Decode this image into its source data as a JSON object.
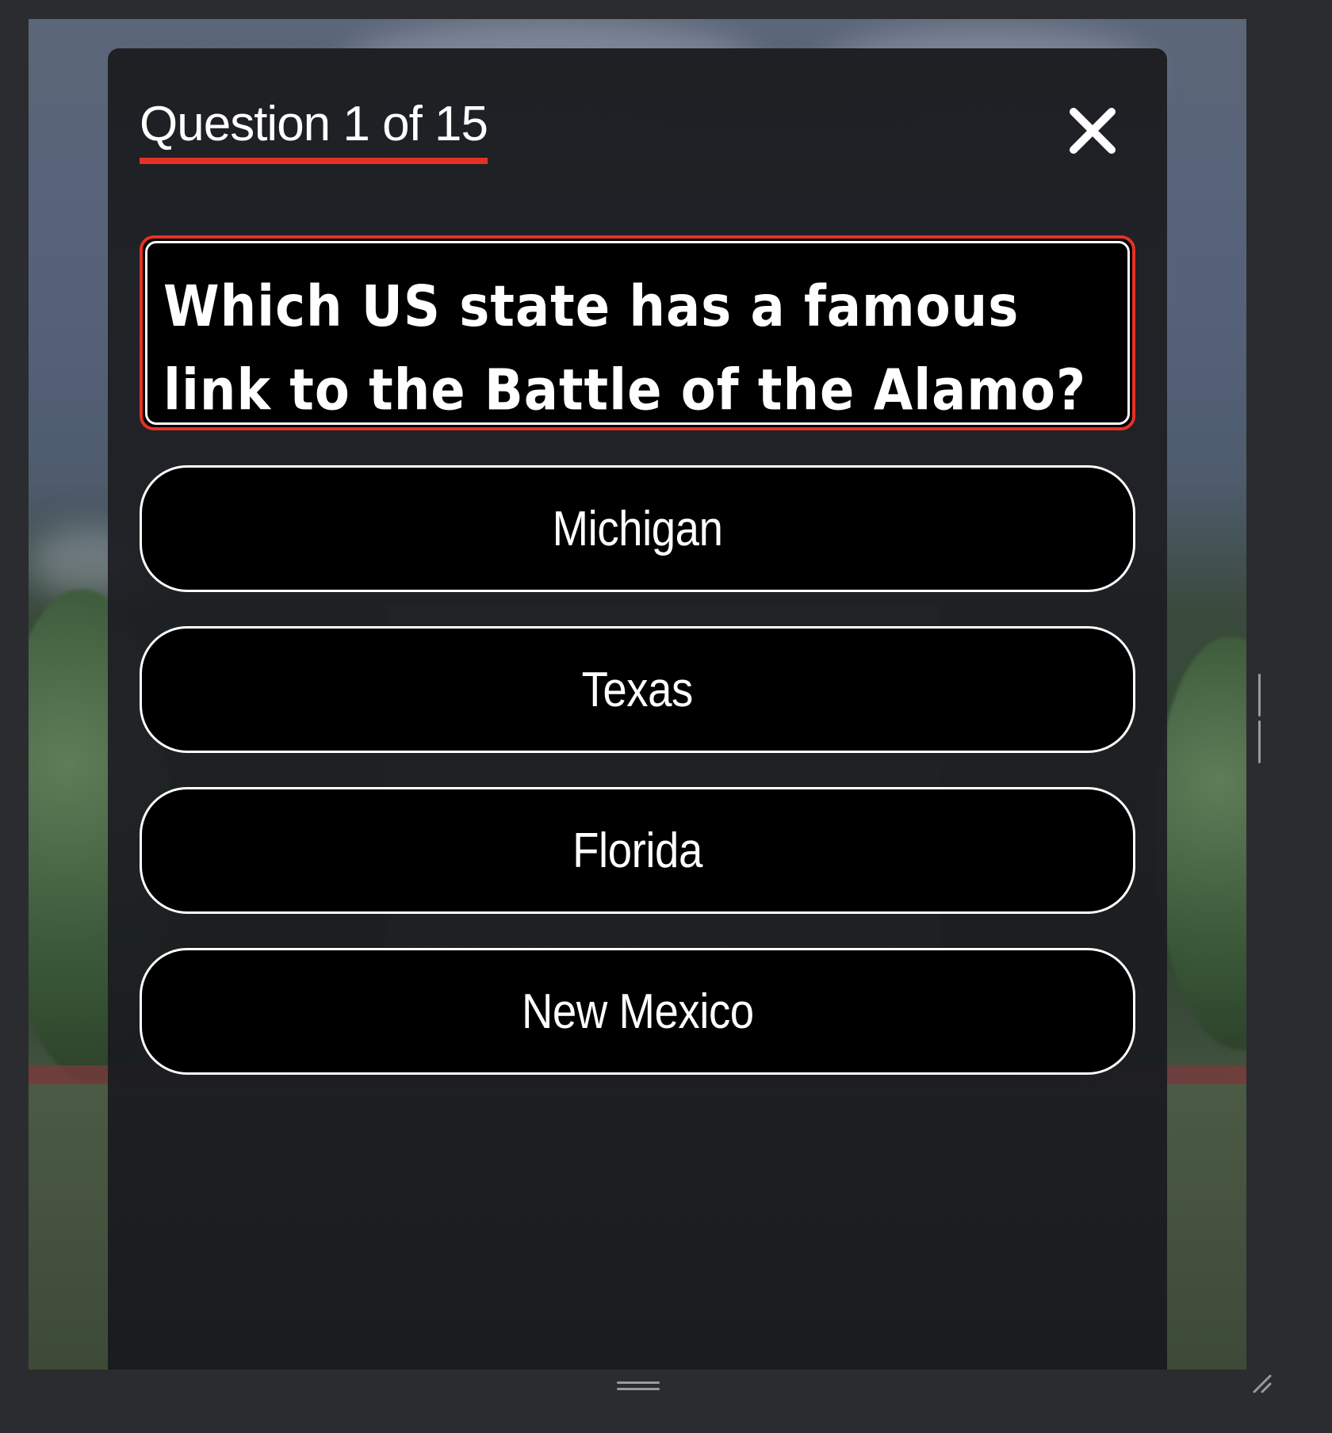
{
  "header": {
    "counter_text": "Question 1 of 15",
    "close_icon": "close-icon"
  },
  "question": {
    "text": "Which US state has a famous link to the Battle of the Alamo?"
  },
  "answers": [
    {
      "label": "Michigan"
    },
    {
      "label": "Texas"
    },
    {
      "label": "Florida"
    },
    {
      "label": "New Mexico"
    }
  ],
  "colors": {
    "accent": "#e53224",
    "panel": "#1e2024",
    "answer_bg": "#000000",
    "text": "#ffffff"
  }
}
